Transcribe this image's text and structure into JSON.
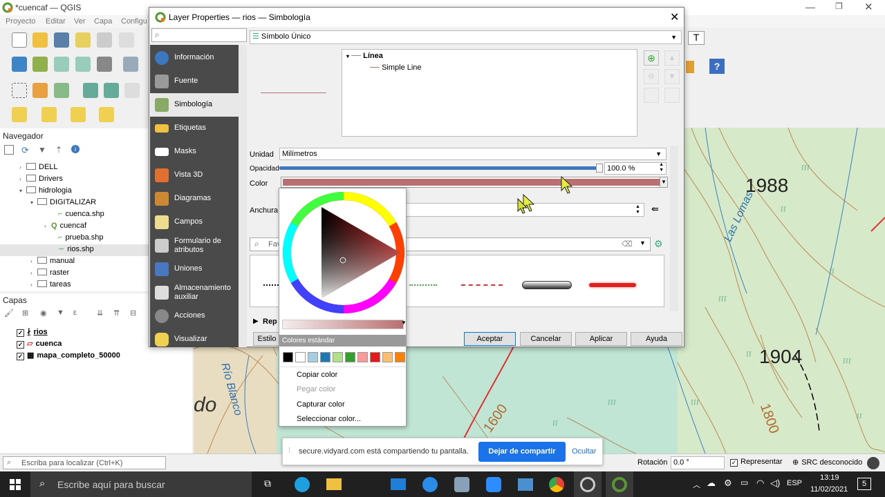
{
  "app": {
    "title": "*cuencaf — QGIS",
    "menu": [
      "Proyecto",
      "Editar",
      "Ver",
      "Capa",
      "Configu"
    ]
  },
  "navigator": {
    "title": "Navegador",
    "tree": [
      "DELL",
      "Drivers",
      "hidrologia",
      "DIGITALIZAR",
      "cuenca.shp",
      "cuencaf",
      "prueba.shp",
      "rios.shp",
      "manual",
      "raster",
      "tareas"
    ]
  },
  "layers": {
    "title": "Capas",
    "items": [
      "rios",
      "cuenca",
      "mapa_completo_50000"
    ]
  },
  "map": {
    "elevations": [
      "1988",
      "1904"
    ],
    "contours": [
      "1600",
      "1800"
    ],
    "labels": [
      "do",
      "Las Lomas",
      "Río Blanco"
    ]
  },
  "dialog": {
    "title": "Layer Properties — rios — Simbología",
    "renderer": "Símbolo Único",
    "sidebar": [
      "Información",
      "Fuente",
      "Simbología",
      "Etiquetas",
      "Masks",
      "Vista 3D",
      "Diagramas",
      "Campos",
      "Formulario de atributos",
      "Uniones",
      "Almacenamiento auxiliar",
      "Acciones",
      "Visualizar"
    ],
    "symbol_tree": {
      "root": "Línea",
      "child": "Simple Line"
    },
    "unit_label": "Unidad",
    "unit_value": "Milímetros",
    "opacity_label": "Opacidad",
    "opacity_value": "100.0 %",
    "opacity": 1.0,
    "color_label": "Color",
    "color_value": "#b87070",
    "width_label": "Anchura",
    "search_placeholder": "Fav",
    "rep_label": "Rep",
    "style_label": "Estilo",
    "buttons": {
      "ok": "Aceptar",
      "cancel": "Cancelar",
      "apply": "Aplicar",
      "help": "Ayuda"
    }
  },
  "color_popup": {
    "standard_colors_label": "Colores estándar",
    "swatches": [
      "#000000",
      "#ffffff",
      "#a6cee3",
      "#1f78b4",
      "#b2df8a",
      "#33a02c",
      "#fb9a99",
      "#e31a1c",
      "#fdbf6f",
      "#ff7f00"
    ],
    "menu": [
      "Copiar color",
      "Pegar color",
      "Capturar color",
      "Seleccionar color..."
    ]
  },
  "share_bar": {
    "message": "secure.vidyard.com está compartiendo tu pantalla.",
    "stop_button": "Dejar de compartir",
    "hide_button": "Ocultar"
  },
  "statusbar": {
    "search_placeholder": "Escriba para localizar (Ctrl+K)",
    "rotation_label": "Rotación",
    "rotation_value": "0.0 °",
    "render_label": "Representar",
    "crs_label": "SRC desconocido"
  },
  "taskbar": {
    "search_placeholder": "Escribe aquí para buscar",
    "language": "ESP",
    "time": "13:19",
    "date": "11/02/2021",
    "notifications": "5"
  }
}
